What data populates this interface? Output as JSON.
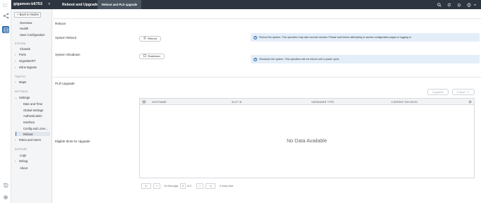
{
  "topbar": {
    "device": "gigamon-b6753",
    "chevron": ">",
    "title": "Reboot and Upgrade",
    "active_tab": "Reboot and PLD upgrade"
  },
  "sidebar": {
    "back_label": "< Back to Nodes",
    "top_items": [
      "Overview",
      "Health",
      "Save Configuration"
    ],
    "system_heading": "SYSTEM",
    "chassis": "Chassis",
    "ports": "Ports",
    "gigasmart": "GigaSMART",
    "inline_bypass": "Inline Bypass",
    "traffic_heading": "TRAFFIC",
    "maps": "Maps",
    "settings_heading": "SETTINGS",
    "settings": "Settings",
    "settings_children": [
      "Date and Time",
      "Global Settings",
      "Authentication",
      "Interface",
      "Config and Licen...",
      "Reboot"
    ],
    "roles_users": "Roles and Users",
    "support_heading": "SUPPORT",
    "logs": "Logs",
    "debug": "Debug",
    "about": "About"
  },
  "reboot": {
    "section_title": "Reboot",
    "system_reboot_label": "System Reboot",
    "reboot_button": "Reboot",
    "reboot_info": "Reboot the system. This operation may take several minutes. Please wait before attempting to access configuration pages or logging in.",
    "system_shutdown_label": "System Shutdown",
    "shutdown_button": "Shutdown",
    "shutdown_info": "Shutdown the system. This operation will not reboot until a power cycle."
  },
  "pld": {
    "section_title": "PLD Upgrade",
    "eligible_label": "Eligible Slots for Upgrade",
    "upgrade_button": "Upgrade",
    "export_button": "Export",
    "columns": [
      "HOSTNAME",
      "SLOT ID",
      "HARDWARE TYPE",
      "CURRENT REVISION"
    ],
    "empty_text": "No Data Available",
    "pager": {
      "first": "|<",
      "prev": "<",
      "page_label": "On this page",
      "page_value": "0",
      "of_label": "of 0",
      "next": ">",
      "last": ">|",
      "count_text": "0 entry total"
    }
  }
}
